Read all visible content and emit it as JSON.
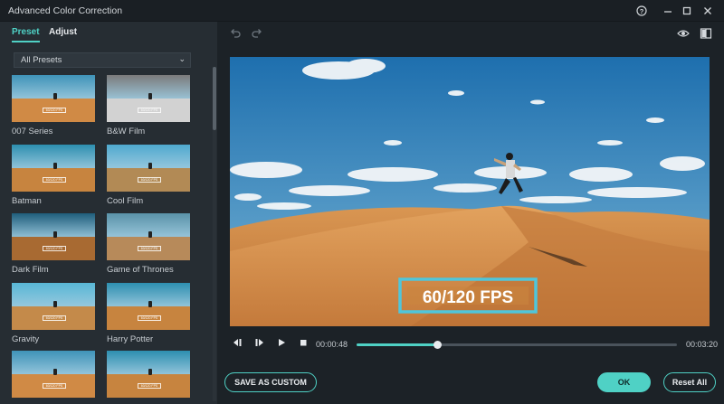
{
  "window": {
    "title": "Advanced Color Correction",
    "buttons": [
      "help-icon",
      "minimize-icon",
      "maximize-icon",
      "close-icon"
    ]
  },
  "tabs": [
    {
      "label": "Preset",
      "active": true
    },
    {
      "label": "Adjust",
      "active": false
    }
  ],
  "preset_filter": {
    "selected": "All Presets"
  },
  "presets": [
    {
      "label": "007 Series",
      "style": "warm"
    },
    {
      "label": "B&W Film",
      "style": "bw"
    },
    {
      "label": "Batman",
      "style": "teal"
    },
    {
      "label": "Cool Film",
      "style": "cool"
    },
    {
      "label": "Dark Film",
      "style": "dark"
    },
    {
      "label": "Game of Thrones",
      "style": "muted"
    },
    {
      "label": "Gravity",
      "style": "cyan"
    },
    {
      "label": "Harry Potter",
      "style": "teal"
    },
    {
      "label": "",
      "style": "warm"
    },
    {
      "label": "",
      "style": "teal"
    }
  ],
  "thumb_tag": "60/120 FPS",
  "toolbar": {
    "icons": [
      "undo-icon",
      "redo-icon",
      "eye-icon",
      "compare-icon"
    ]
  },
  "preview": {
    "overlay_text": "60/120 FPS",
    "colors": {
      "sky_top": "#1e6fae",
      "sky_bottom": "#78b5d6",
      "sand": "#d08a45",
      "frame": "#4fc6db"
    }
  },
  "playback": {
    "current_time": "00:00:48",
    "total_time": "00:03:20",
    "progress": 0.25
  },
  "buttons": {
    "save_custom": "SAVE AS CUSTOM",
    "ok": "OK",
    "reset_all": "Reset All"
  },
  "colors": {
    "accent": "#4fd1c5",
    "panel": "#262d33",
    "background": "#1c2227"
  }
}
